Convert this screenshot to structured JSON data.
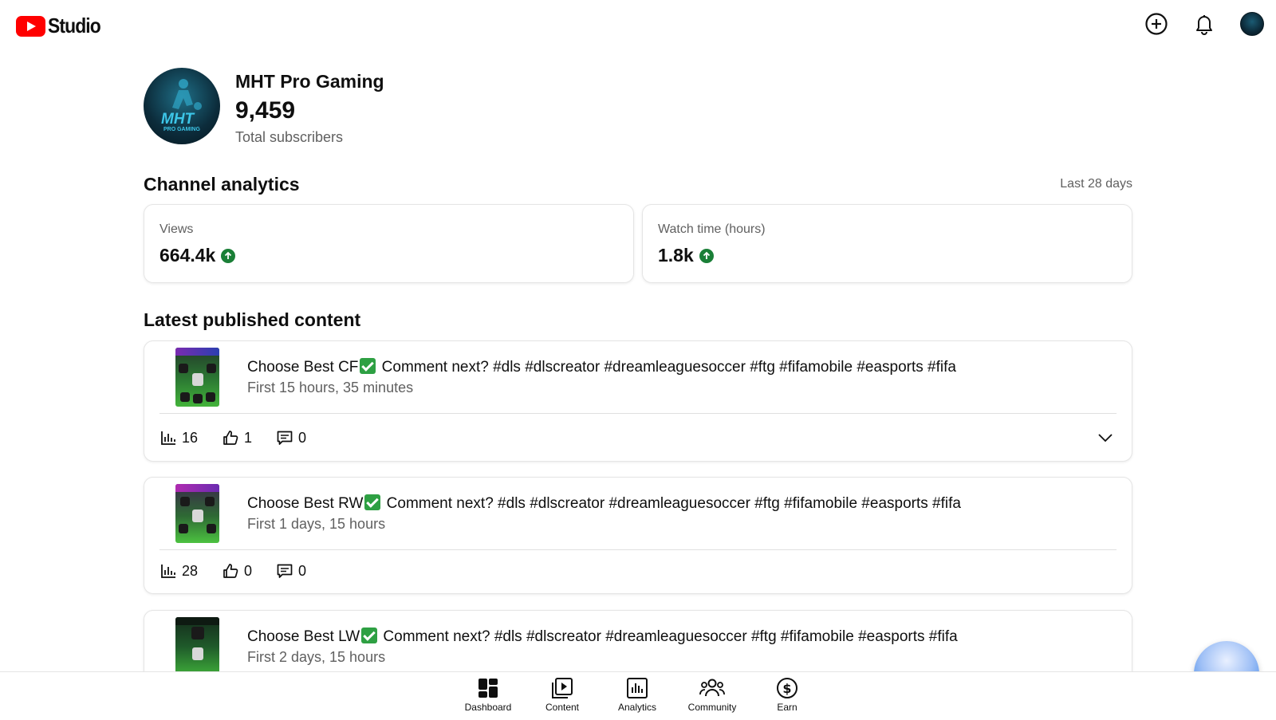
{
  "app": {
    "logo_text": "Studio"
  },
  "header_icons": [
    "create-icon",
    "notifications-icon",
    "account-avatar"
  ],
  "channel": {
    "name": "MHT Pro Gaming",
    "subscribers": "9,459",
    "subscribers_label": "Total subscribers",
    "avatar_mark": "MHT",
    "avatar_sub": "PRO GAMING"
  },
  "analytics": {
    "title": "Channel analytics",
    "period": "Last 28 days",
    "views_label": "Views",
    "views_value": "664.4k",
    "watch_label": "Watch time (hours)",
    "watch_value": "1.8k",
    "trend": "up",
    "trend_color": "#1a7f37"
  },
  "content": {
    "title": "Latest published content",
    "videos": [
      {
        "title_a": "Choose Best CF",
        "title_b": " Comment next? #dls #dlscreator #dreamleaguesoccer #ftg #fifamobile #easports #fifa",
        "period": "First 15 hours, 35 minutes",
        "views": "16",
        "likes": "1",
        "comments": "0"
      },
      {
        "title_a": "Choose Best RW",
        "title_b": " Comment next? #dls #dlscreator #dreamleaguesoccer #ftg #fifamobile #easports #fifa",
        "period": "First 1 days, 15 hours",
        "views": "28",
        "likes": "0",
        "comments": "0"
      },
      {
        "title_a": "Choose Best LW",
        "title_b": " Comment next? #dls #dlscreator #dreamleaguesoccer #ftg #fifamobile #easports #fifa",
        "period": "First 2 days, 15 hours"
      }
    ]
  },
  "bottom_nav": [
    {
      "label": "Dashboard",
      "icon": "dashboard-icon"
    },
    {
      "label": "Content",
      "icon": "content-icon"
    },
    {
      "label": "Analytics",
      "icon": "analytics-icon"
    },
    {
      "label": "Community",
      "icon": "community-icon"
    },
    {
      "label": "Earn",
      "icon": "earn-icon"
    }
  ],
  "colors": {
    "brand": "#ff0000",
    "text": "#0f0f0f",
    "secondary_text": "#606060",
    "border": "#e5e5e5"
  }
}
